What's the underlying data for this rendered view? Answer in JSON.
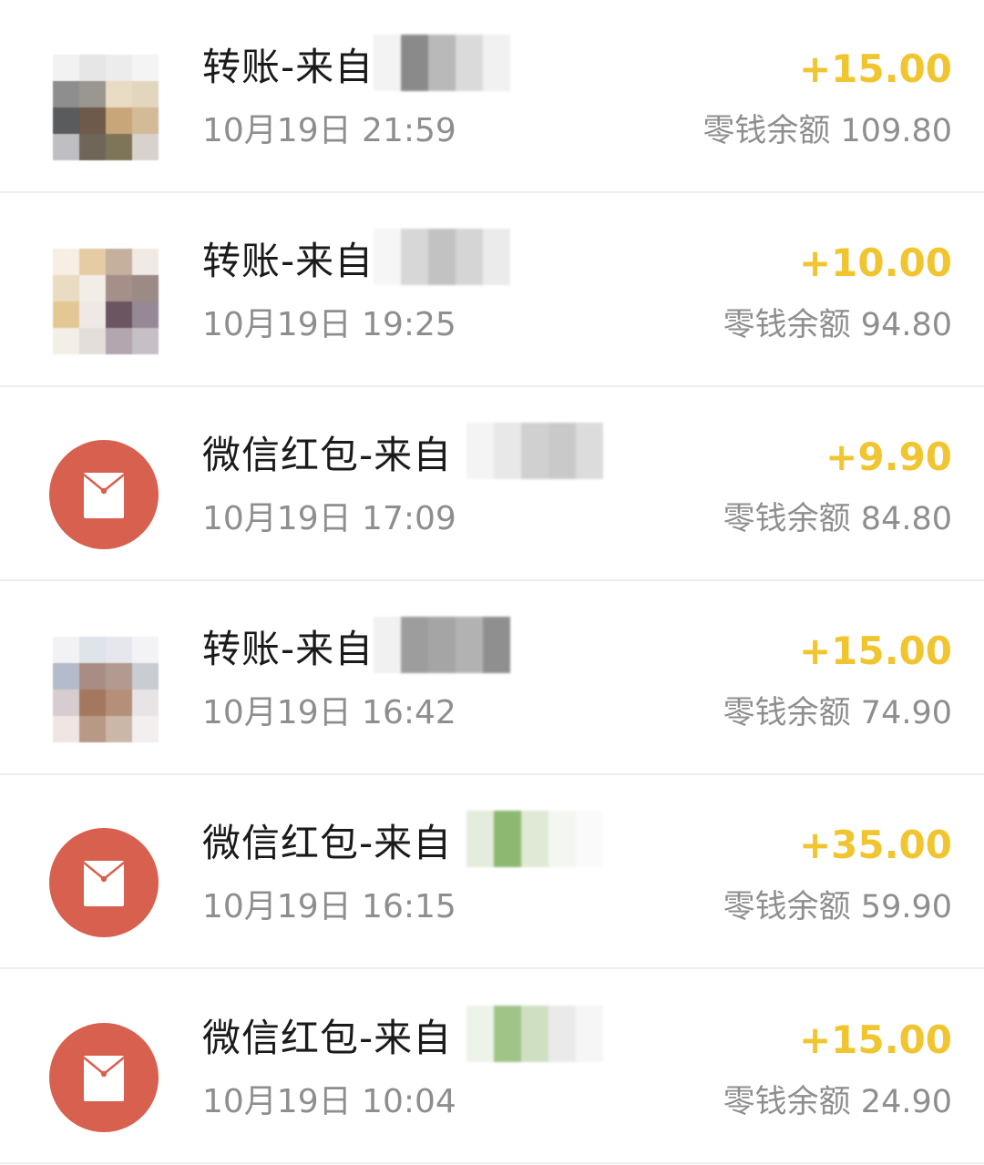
{
  "transactions": [
    {
      "type": "transfer",
      "title": "转账-来自",
      "time": "10月19日 21:59",
      "amount": "+15.00",
      "balance": "零钱余额 109.80",
      "avatar_colors": [
        "#f2f2f2",
        "#e6e6e6",
        "#ececec",
        "#f4f4f4",
        "#8e8e8e",
        "#9a9791",
        "#e8dcc4",
        "#e2d6bf",
        "#5a5b5c",
        "#6d5a48",
        "#c9a679",
        "#d2bb96",
        "#bfbfc3",
        "#6f6559",
        "#7e7458",
        "#d7d3cc"
      ],
      "mask_colors": [
        "#f3f3f3",
        "#8a8a8a",
        "#b9b9b9",
        "#dadada",
        "#f1f1f1"
      ]
    },
    {
      "type": "transfer",
      "title": "转账-来自",
      "time": "10月19日 19:25",
      "amount": "+10.00",
      "balance": "零钱余额 94.80",
      "avatar_colors": [
        "#f7efe3",
        "#e5cca3",
        "#c4b09d",
        "#f0e9e4",
        "#eadbc3",
        "#f2ede7",
        "#a58f88",
        "#9c8a85",
        "#e3c896",
        "#efe9e6",
        "#6b5560",
        "#968995",
        "#f3eee6",
        "#e4dedb",
        "#b3a6af",
        "#c7bfc6"
      ],
      "mask_colors": [
        "#f6f6f6",
        "#d7d7d7",
        "#c2c2c2",
        "#d5d5d5",
        "#ebebeb"
      ]
    },
    {
      "type": "redpacket",
      "title": "微信红包-来自",
      "time": "10月19日 17:09",
      "amount": "+9.90",
      "balance": "零钱余额 84.80",
      "mask_colors": [
        "#f4f4f4",
        "#e8e8e8",
        "#d0d0d0",
        "#c9c9c9",
        "#dcdcdc"
      ]
    },
    {
      "type": "transfer",
      "title": "转账-来自",
      "time": "10月19日 16:42",
      "amount": "+15.00",
      "balance": "零钱余额 74.90",
      "avatar_colors": [
        "#f2f2f4",
        "#dfe3ea",
        "#e5e7ec",
        "#f3f3f5",
        "#b4bccb",
        "#a98d84",
        "#b39a90",
        "#c9ccd3",
        "#d7cdd1",
        "#a4785e",
        "#b58f7a",
        "#e8e3e4",
        "#efe6e3",
        "#b89986",
        "#cbb7a8",
        "#f2efee"
      ],
      "mask_colors": [
        "#f1f1f1",
        "#9d9d9d",
        "#a5a5a5",
        "#b2b2b2",
        "#8f8f8f"
      ]
    },
    {
      "type": "redpacket",
      "title": "微信红包-来自",
      "time": "10月19日 16:15",
      "amount": "+35.00",
      "balance": "零钱余额 59.90",
      "mask_colors": [
        "#e4ecdc",
        "#8db86f",
        "#dfe9d6",
        "#f4f7f1",
        "#fafafa"
      ]
    },
    {
      "type": "redpacket",
      "title": "微信红包-来自",
      "time": "10月19日 10:04",
      "amount": "+15.00",
      "balance": "零钱余额 24.90",
      "mask_colors": [
        "#eef3ea",
        "#9fc488",
        "#cfe0c2",
        "#eaeaea",
        "#f6f6f6"
      ]
    }
  ],
  "colors": {
    "amount": "#f0c530",
    "redpacket_circle": "#d8604f",
    "secondary_text": "#8e8e8e"
  },
  "icons": {
    "redpacket": "red-envelope-icon"
  }
}
